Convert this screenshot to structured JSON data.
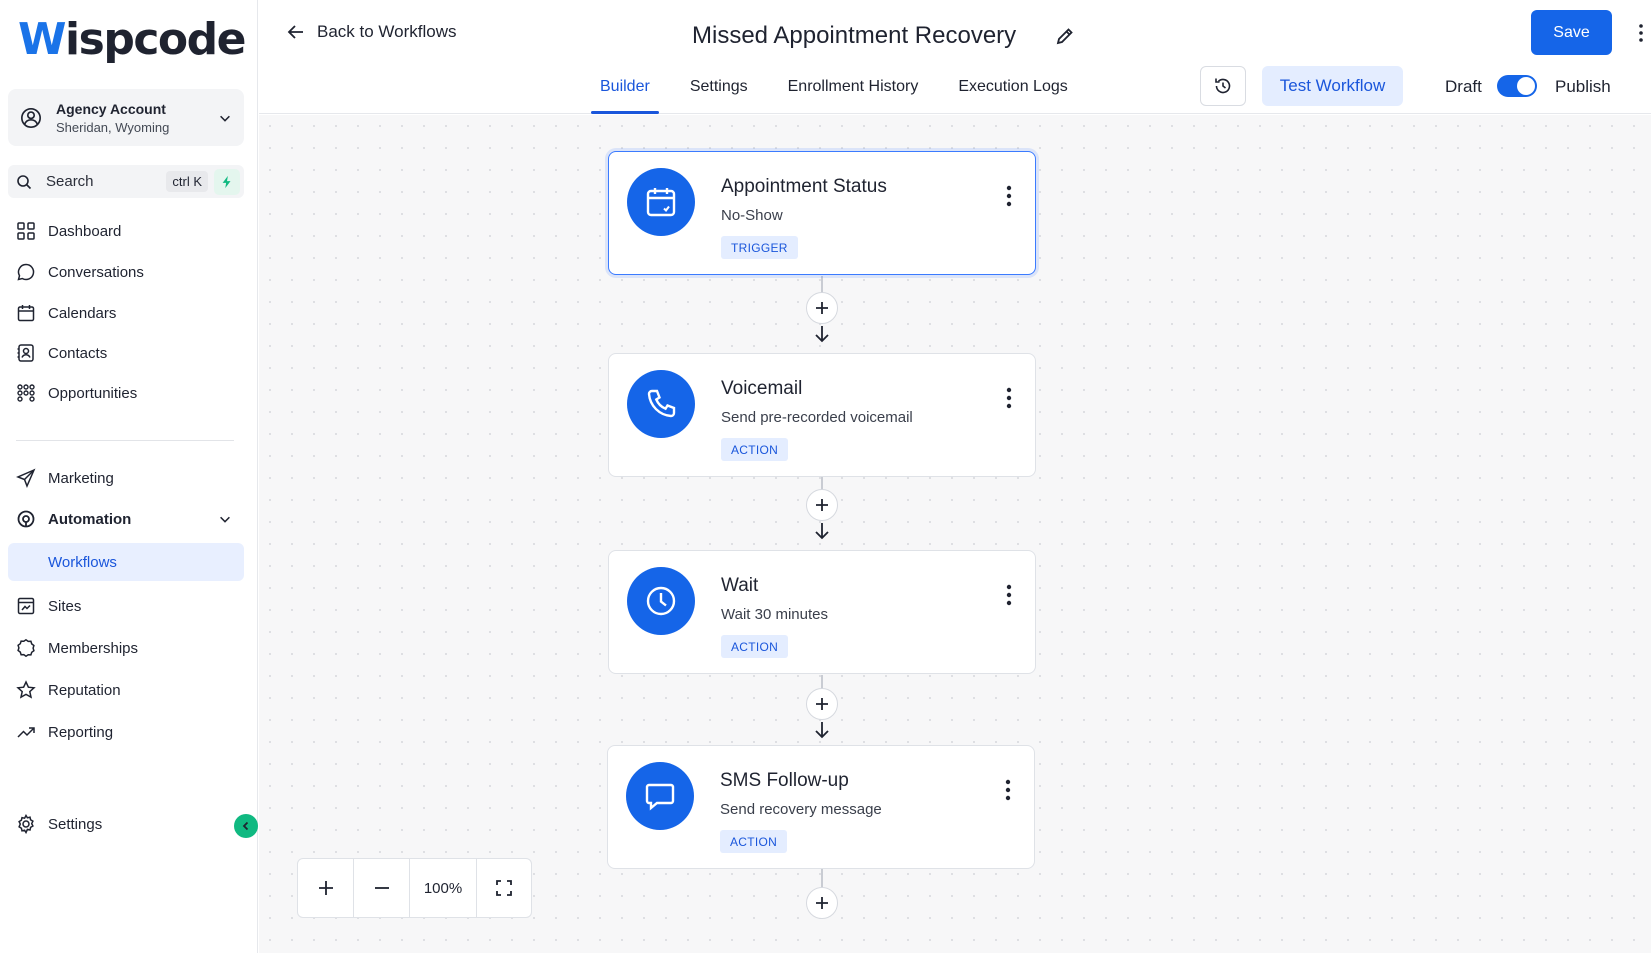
{
  "brand": {
    "logo_initial": "W",
    "logo_rest": "ispcode"
  },
  "account": {
    "name": "Agency Account",
    "location": "Sheridan, Wyoming"
  },
  "search": {
    "label": "Search",
    "shortcut": "ctrl K"
  },
  "nav": {
    "dashboard": "Dashboard",
    "conversations": "Conversations",
    "calendars": "Calendars",
    "contacts": "Contacts",
    "opportunities": "Opportunities",
    "marketing": "Marketing",
    "automation": "Automation",
    "workflows": "Workflows",
    "sites": "Sites",
    "memberships": "Memberships",
    "reputation": "Reputation",
    "reporting": "Reporting",
    "settings": "Settings"
  },
  "header": {
    "back_label": "Back to Workflows",
    "title": "Missed Appointment Recovery",
    "save_label": "Save",
    "tabs": [
      "Builder",
      "Settings",
      "Enrollment History",
      "Execution Logs"
    ],
    "active_tab": "Builder",
    "test_label": "Test Workflow",
    "draft_label": "Draft",
    "publish_label": "Publish",
    "publish_toggle_on": true
  },
  "nodes": [
    {
      "title": "Appointment Status",
      "subtitle": "No-Show",
      "tag": "TRIGGER",
      "icon": "calendar-icon"
    },
    {
      "title": "Voicemail",
      "subtitle": "Send pre-recorded voicemail",
      "tag": "ACTION",
      "icon": "phone-icon"
    },
    {
      "title": "Wait",
      "subtitle": "Wait 30 minutes",
      "tag": "ACTION",
      "icon": "clock-icon"
    },
    {
      "title": "SMS Follow-up",
      "subtitle": "Send recovery message",
      "tag": "ACTION",
      "icon": "message-icon"
    }
  ],
  "zoom": {
    "level": "100%"
  },
  "colors": {
    "accent": "#1565e8",
    "accent_light": "#e4edff",
    "success": "#10b981"
  }
}
